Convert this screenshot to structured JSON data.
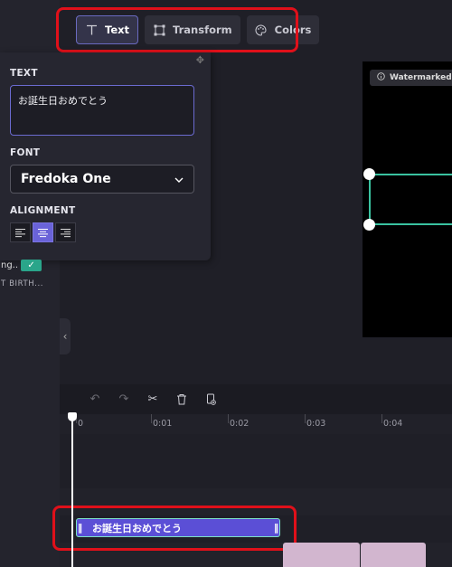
{
  "toolbar": {
    "tabs": [
      {
        "label": "Text",
        "icon": "text-icon",
        "active": true
      },
      {
        "label": "Transform",
        "icon": "transform-icon",
        "active": false
      },
      {
        "label": "Colors",
        "icon": "palette-icon",
        "active": false
      }
    ]
  },
  "panel": {
    "text_label": "TEXT",
    "text_value": "お誕生日おめでとう",
    "font_label": "FONT",
    "font_value": "Fredoka One",
    "alignment_label": "ALIGNMENT",
    "alignment_options": [
      "left",
      "center",
      "right"
    ],
    "alignment_selected": "center"
  },
  "left": {
    "track_chip_text": "ng..",
    "birth_label": "T BIRTH..."
  },
  "preview": {
    "watermark_label": "Watermarked"
  },
  "timeline": {
    "ticks": [
      "0",
      "0:01",
      "0:02",
      "0:03",
      "0:04"
    ],
    "clip_text": "お誕生日おめでとう"
  },
  "colors": {
    "accent": "#6a63d8",
    "highlight": "#e0101a",
    "selection": "#3ac2a0"
  }
}
